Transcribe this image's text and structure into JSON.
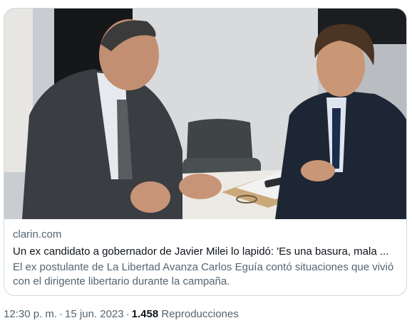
{
  "link_card": {
    "image_alt": "Javier Milei conversando con Carlos Eguía",
    "domain": "clarin.com",
    "title": "Un ex candidato a gobernador de Javier Milei lo lapidó: 'Es una basura, mala ...",
    "description": "El ex postulante de La Libertad Avanza Carlos Eguía contó situaciones que vivió con el dirigente libertario durante la campaña."
  },
  "tweet_meta": {
    "time": "12:30 p. m.",
    "separator": "·",
    "date": "15 jun. 2023",
    "views_count": "1.458",
    "views_label": "Reproducciones"
  }
}
